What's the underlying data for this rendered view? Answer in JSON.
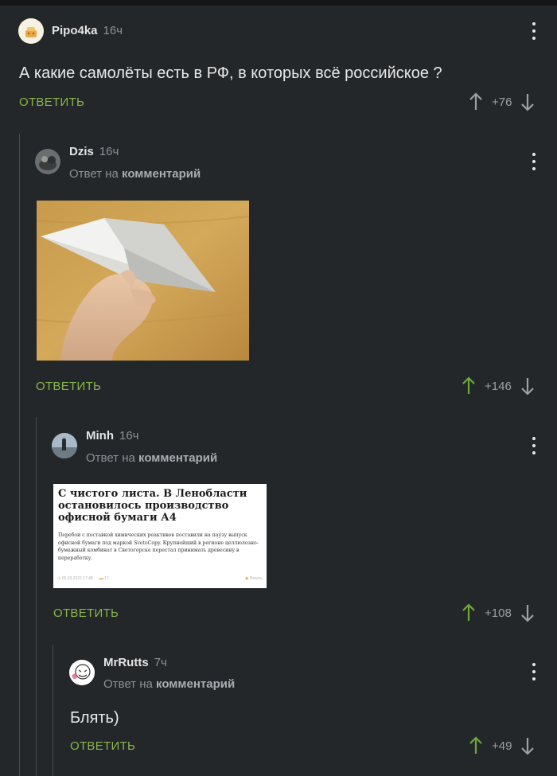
{
  "comments": [
    {
      "author": "Pipo4ka",
      "time": "16ч",
      "text": "А какие самолёты есть в РФ, в которых всё российское ?",
      "answer": "ОТВЕТИТЬ",
      "score": "+76",
      "upvoted": false
    },
    {
      "author": "Dzis",
      "time": "16ч",
      "reply_prefix": "Ответ на",
      "reply_target": "комментарий",
      "answer": "ОТВЕТИТЬ",
      "score": "+146",
      "upvoted": true
    },
    {
      "author": "Minh",
      "time": "16ч",
      "reply_prefix": "Ответ на",
      "reply_target": "комментарий",
      "answer": "ОТВЕТИТЬ",
      "score": "+108",
      "upvoted": true,
      "news": {
        "headline": "С чистого листа. В Ленобласти остановилось производство офисной бумаги А4",
        "lead": "Перебои с поставкой химических реактивов поставили на паузу выпуск офисной бумаги под маркой SvetoCopy. Крупнейший в регионе целлюлозно-бумажный комбинат в Светогорске перестал принимать древесину в переработку.",
        "date": "05.03.2022 17:48",
        "comments_count": "17",
        "print_label": "Печать"
      }
    },
    {
      "author": "MrRutts",
      "time": "7ч",
      "reply_prefix": "Ответ на",
      "reply_target": "комментарий",
      "text": "Блять)",
      "answer": "ОТВЕТИТЬ",
      "score": "+49",
      "upvoted": true
    }
  ],
  "colors": {
    "background": "#24272a",
    "accent_green": "#8ab64a",
    "text": "#e8e8e8",
    "muted": "#8d9095"
  }
}
